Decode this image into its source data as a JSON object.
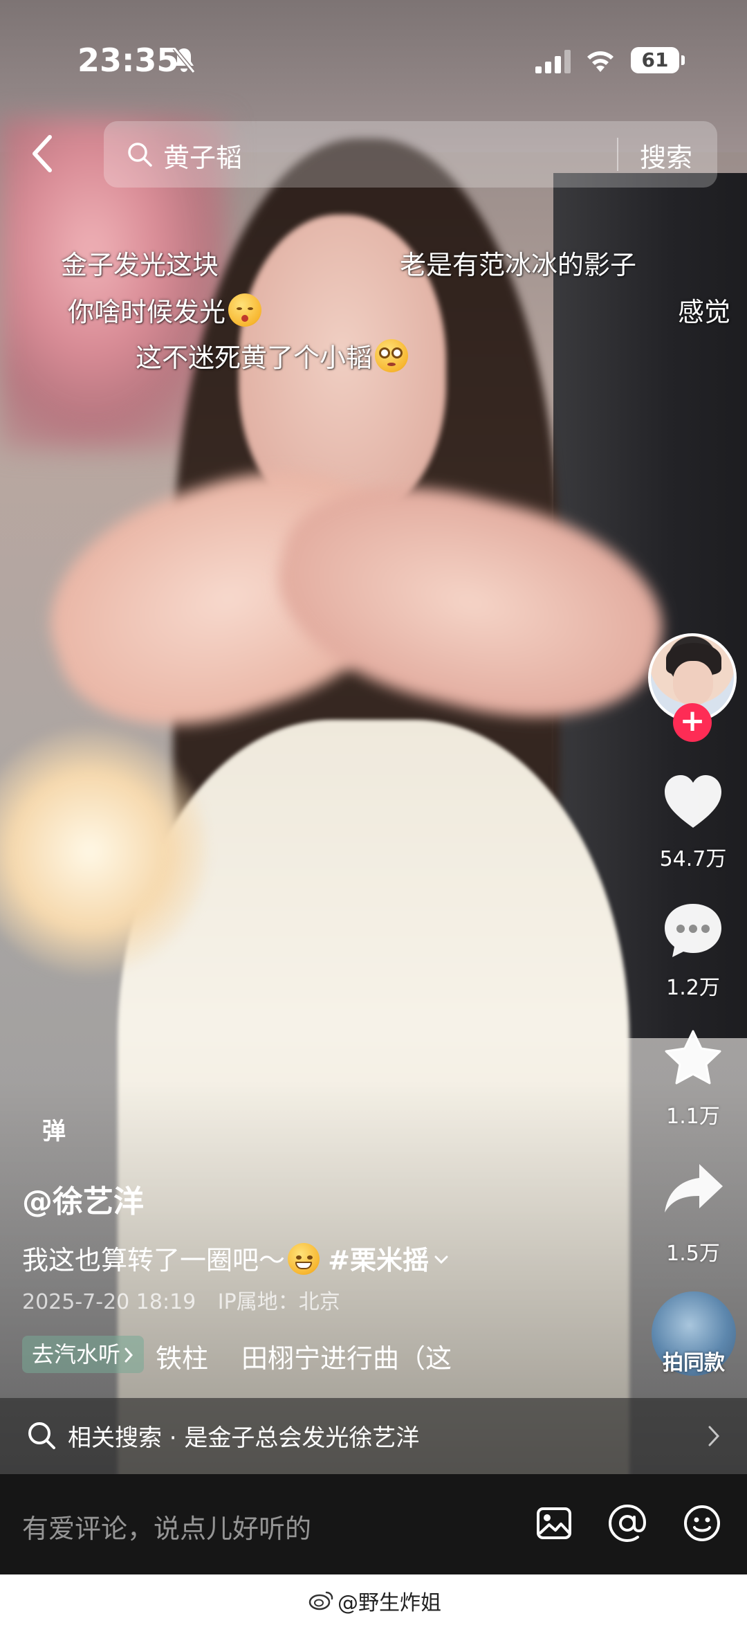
{
  "status_bar": {
    "time": "23:35",
    "battery": "61"
  },
  "search": {
    "query": "黄子韬",
    "button": "搜索"
  },
  "danmaku": [
    {
      "text": "金子发光这块"
    },
    {
      "text": "老是有范冰冰的影子"
    },
    {
      "text": "你啥时候发光"
    },
    {
      "text": "感觉"
    },
    {
      "text": "这不迷死黄了个小韬"
    }
  ],
  "actions": {
    "likes": "54.7万",
    "comments": "1.2万",
    "favorites": "1.1万",
    "shares": "1.5万",
    "same_style": "拍同款"
  },
  "danmaku_toggle": "弹",
  "post": {
    "author": "@徐艺洋",
    "description": "我这也算转了一圈吧～",
    "hashtag": "#栗米摇",
    "date": "2025-7-20 18:19",
    "ip": "IP属地：北京",
    "music_chip": "去汽水听",
    "music_title": "铁柱",
    "music_title_2": "田栩宁进行曲（这"
  },
  "related_search": {
    "label": "相关搜索 · 是金子总会发光徐艺洋"
  },
  "comment": {
    "placeholder": "有爱评论，说点儿好听的"
  },
  "footer": {
    "watermark": "@野生炸姐"
  },
  "icons": {
    "back": "back-arrow-icon",
    "search": "search-icon",
    "like": "heart-icon",
    "comment": "comment-bubble-icon",
    "favorite": "star-icon",
    "share": "share-arrow-icon",
    "image": "image-icon",
    "mention": "at-sign-icon",
    "emoji": "smiley-icon"
  },
  "colors": {
    "follow_button": "#fe2c55",
    "comment_bar": "#161616",
    "chip": "#78aa96"
  }
}
